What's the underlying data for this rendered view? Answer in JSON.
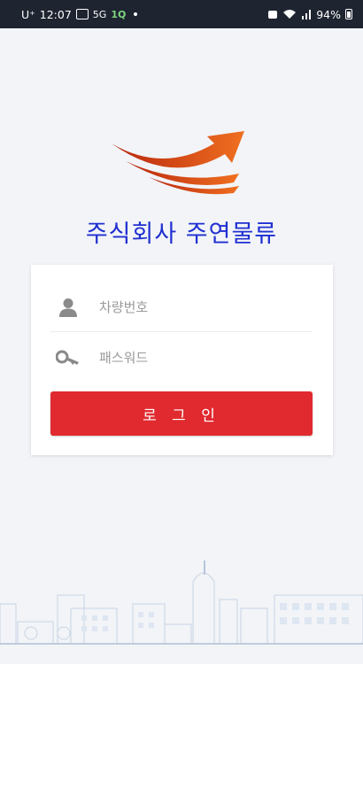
{
  "status_bar": {
    "carrier": "U⁺",
    "time": "12:07",
    "network_label": "5G",
    "app_badge": "1Q",
    "battery": "94%"
  },
  "company": {
    "name": "주식회사 주연물류"
  },
  "login_form": {
    "vehicle_number_placeholder": "차량번호",
    "vehicle_number_value": "",
    "password_placeholder": "패스워드",
    "password_value": "",
    "login_label": "로 그 인"
  },
  "icons": {
    "user": "user-icon",
    "key": "key-icon",
    "logo": "arrow-logo-icon"
  },
  "colors": {
    "brand_text": "#1f2fd1",
    "login_button": "#e02a2f",
    "logo_orange": "#e8581b",
    "status_bar": "#1e2430"
  }
}
